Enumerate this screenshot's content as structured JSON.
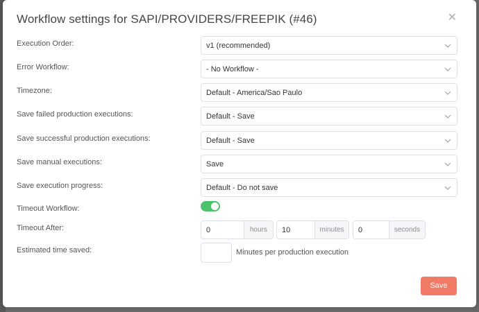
{
  "modal": {
    "title": "Workflow settings for SAPI/PROVIDERS/FREEPIK (#46)",
    "close_icon": "close-icon"
  },
  "fields": {
    "execution_order": {
      "label": "Execution Order:",
      "value": "v1 (recommended)"
    },
    "error_workflow": {
      "label": "Error Workflow:",
      "value": "- No Workflow -"
    },
    "timezone": {
      "label": "Timezone:",
      "value": "Default - America/Sao Paulo"
    },
    "save_failed": {
      "label": "Save failed production executions:",
      "value": "Default - Save"
    },
    "save_successful": {
      "label": "Save successful production executions:",
      "value": "Default - Save"
    },
    "save_manual": {
      "label": "Save manual executions:",
      "value": "Save"
    },
    "save_progress": {
      "label": "Save execution progress:",
      "value": "Default - Do not save"
    },
    "timeout_workflow": {
      "label": "Timeout Workflow:",
      "enabled": true
    },
    "timeout_after": {
      "label": "Timeout After:",
      "hours": {
        "value": "0",
        "unit": "hours"
      },
      "minutes": {
        "value": "10",
        "unit": "minutes"
      },
      "seconds": {
        "value": "0",
        "unit": "seconds"
      }
    },
    "estimated_time": {
      "label": "Estimated time saved:",
      "value": "",
      "suffix": "Minutes per production execution"
    }
  },
  "actions": {
    "save_label": "Save"
  },
  "colors": {
    "accent": "#f07a66",
    "toggle_on": "#4cc26a",
    "border": "#dcdfe6"
  }
}
